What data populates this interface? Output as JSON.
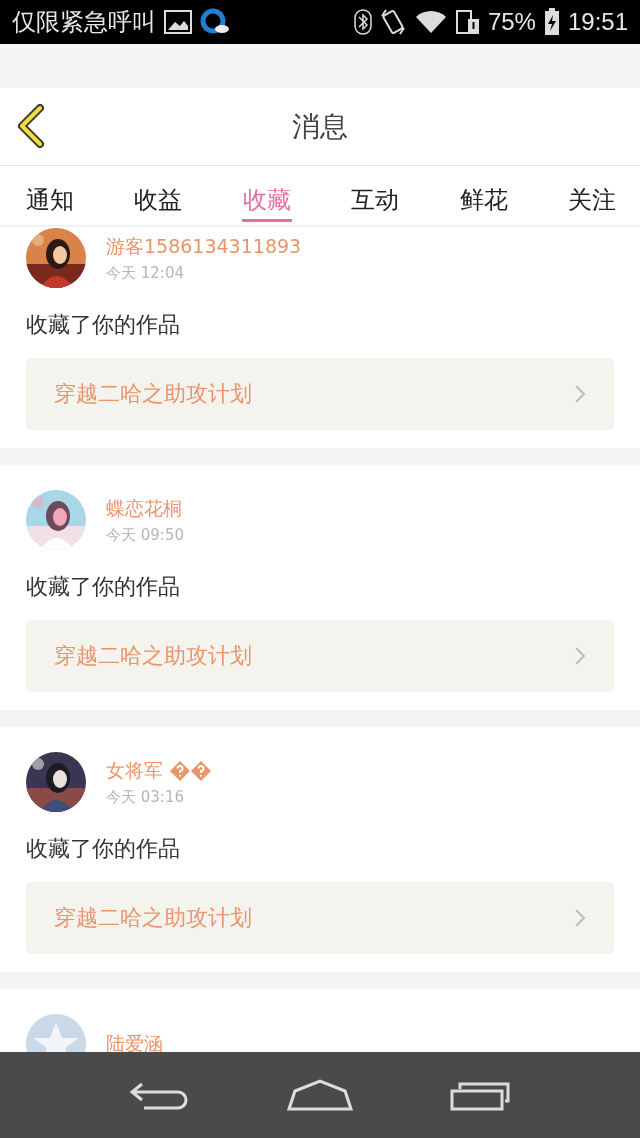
{
  "status_bar": {
    "carrier": "仅限紧急呼叫",
    "battery_text": "75%",
    "time": "19:51"
  },
  "header": {
    "title": "消息"
  },
  "tabs": [
    {
      "label": "通知",
      "selected": false
    },
    {
      "label": "收益",
      "selected": false
    },
    {
      "label": "收藏",
      "selected": true
    },
    {
      "label": "互动",
      "selected": false
    },
    {
      "label": "鲜花",
      "selected": false
    },
    {
      "label": "关注",
      "selected": false
    }
  ],
  "messages": [
    {
      "name": "游客1586134311893",
      "time": "今天 12:04",
      "text": "收藏了你的作品",
      "work": "穿越二哈之助攻计划"
    },
    {
      "name": "蝶恋花桐",
      "time": "今天 09:50",
      "text": "收藏了你的作品",
      "work": "穿越二哈之助攻计划"
    },
    {
      "name": "女将军",
      "badges": [
        {
          "kind": "unknown-glyph"
        },
        {
          "kind": "unknown-glyph"
        }
      ],
      "time": "今天 03:16",
      "text": "收藏了你的作品",
      "work": "穿越二哈之助攻计划"
    },
    {
      "avatar": {
        "kind": "default"
      },
      "name": "陆爱涵"
    }
  ]
}
